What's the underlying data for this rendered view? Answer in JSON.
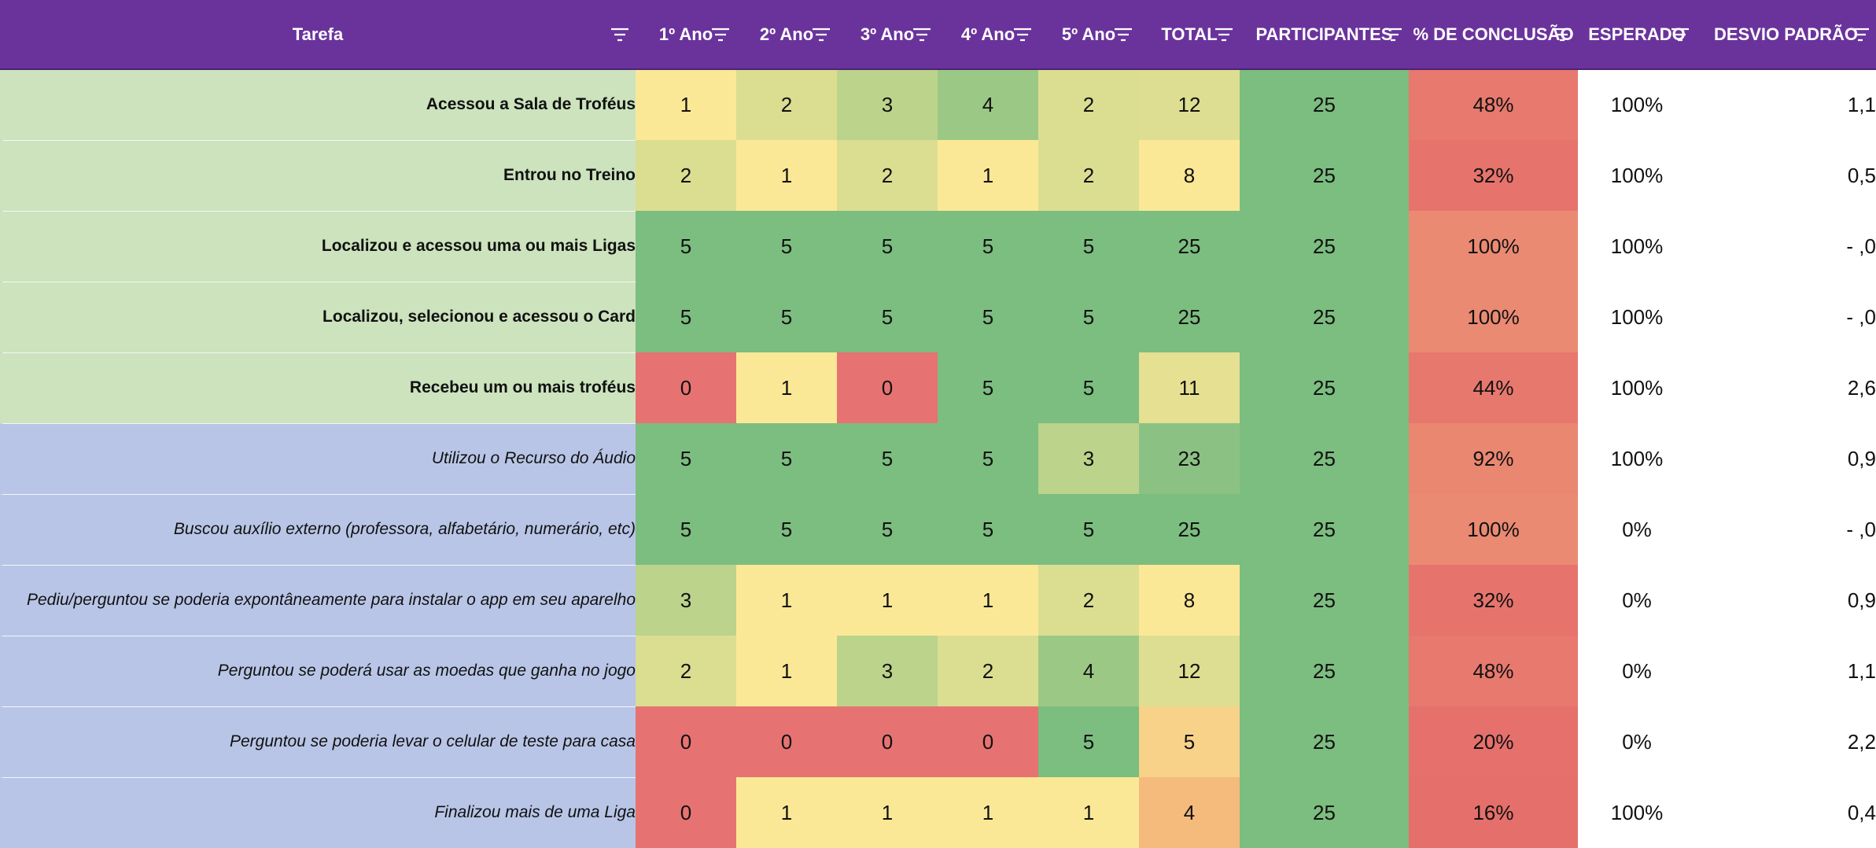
{
  "sheet": {
    "headers": [
      "Tarefa",
      "1º Ano",
      "2º Ano",
      "3º Ano",
      "4º Ano",
      "5º Ano",
      "TOTAL",
      "PARTICIPANTES",
      "% DE CONCLUSÃO",
      "ESPERADO",
      "DESVIO PADRÃO"
    ],
    "icons": {
      "filter": "filter-icon"
    },
    "colors": {
      "header_bg": "#6a339c",
      "group_green": "#cce3bd",
      "group_blue": "#b8c5e6",
      "scale_green": "#7cbd80",
      "scale_yellow": "#fbe896",
      "scale_red": "#e67372",
      "scale_orange": "#f4bb7c"
    },
    "rows": [
      {
        "task": "Acessou a Sala de Troféus",
        "group": "green",
        "style": "bold",
        "y1": "1",
        "y2": "2",
        "y3": "3",
        "y4": "4",
        "y5": "2",
        "total": "12",
        "participants": "25",
        "pct": "48%",
        "expected": "100%",
        "stddev": "1,1"
      },
      {
        "task": "Entrou no Treino",
        "group": "green",
        "style": "bold",
        "y1": "2",
        "y2": "1",
        "y3": "2",
        "y4": "1",
        "y5": "2",
        "total": "8",
        "participants": "25",
        "pct": "32%",
        "expected": "100%",
        "stddev": "0,5"
      },
      {
        "task": "Localizou e acessou uma ou mais Ligas",
        "group": "green",
        "style": "bold",
        "y1": "5",
        "y2": "5",
        "y3": "5",
        "y4": "5",
        "y5": "5",
        "total": "25",
        "participants": "25",
        "pct": "100%",
        "expected": "100%",
        "stddev": "-    ,0"
      },
      {
        "task": "Localizou, selecionou e acessou o Card",
        "group": "green",
        "style": "bold",
        "y1": "5",
        "y2": "5",
        "y3": "5",
        "y4": "5",
        "y5": "5",
        "total": "25",
        "participants": "25",
        "pct": "100%",
        "expected": "100%",
        "stddev": "-    ,0"
      },
      {
        "task": "Recebeu um ou mais troféus",
        "group": "green",
        "style": "bold",
        "y1": "0",
        "y2": "1",
        "y3": "0",
        "y4": "5",
        "y5": "5",
        "total": "11",
        "participants": "25",
        "pct": "44%",
        "expected": "100%",
        "stddev": "2,6"
      },
      {
        "task": "Utilizou o Recurso do Áudio",
        "group": "blue",
        "style": "italic",
        "y1": "5",
        "y2": "5",
        "y3": "5",
        "y4": "5",
        "y5": "3",
        "total": "23",
        "participants": "25",
        "pct": "92%",
        "expected": "100%",
        "stddev": "0,9"
      },
      {
        "task": "Buscou auxílio externo (professora, alfabetário, numerário, etc)",
        "group": "blue",
        "style": "italic",
        "y1": "5",
        "y2": "5",
        "y3": "5",
        "y4": "5",
        "y5": "5",
        "total": "25",
        "participants": "25",
        "pct": "100%",
        "expected": "0%",
        "stddev": "-    ,0"
      },
      {
        "task": "Pediu/perguntou se poderia expontâneamente para instalar o app em seu aparelho",
        "group": "blue",
        "style": "italic",
        "y1": "3",
        "y2": "1",
        "y3": "1",
        "y4": "1",
        "y5": "2",
        "total": "8",
        "participants": "25",
        "pct": "32%",
        "expected": "0%",
        "stddev": "0,9"
      },
      {
        "task": "Perguntou se poderá usar as moedas que ganha no jogo",
        "group": "blue",
        "style": "italic",
        "y1": "2",
        "y2": "1",
        "y3": "3",
        "y4": "2",
        "y5": "4",
        "total": "12",
        "participants": "25",
        "pct": "48%",
        "expected": "0%",
        "stddev": "1,1"
      },
      {
        "task": "Perguntou se poderia levar o celular de teste para casa",
        "group": "blue",
        "style": "italic",
        "y1": "0",
        "y2": "0",
        "y3": "0",
        "y4": "0",
        "y5": "5",
        "total": "5",
        "participants": "25",
        "pct": "20%",
        "expected": "0%",
        "stddev": "2,2"
      },
      {
        "task": "Finalizou mais de uma Liga",
        "group": "blue",
        "style": "italic",
        "y1": "0",
        "y2": "1",
        "y3": "1",
        "y4": "1",
        "y5": "1",
        "total": "4",
        "participants": "25",
        "pct": "16%",
        "expected": "100%",
        "stddev": "0,4"
      }
    ]
  }
}
